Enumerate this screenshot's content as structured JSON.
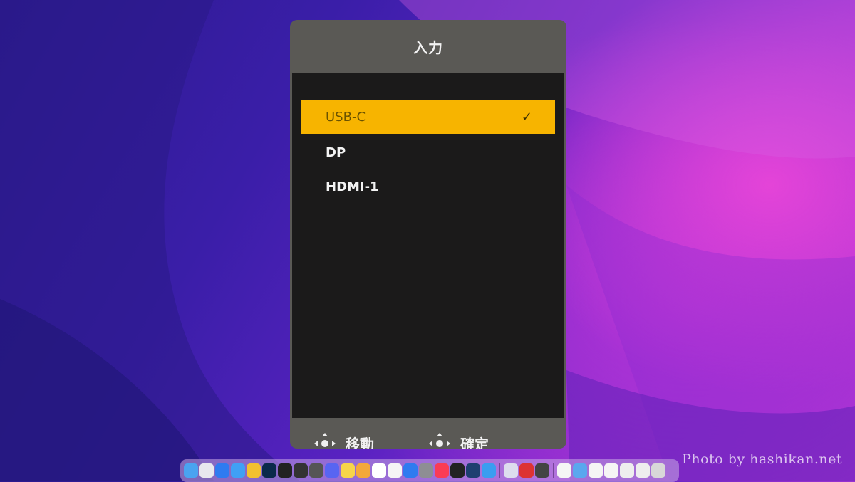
{
  "osd": {
    "title": "入力",
    "items": [
      {
        "label": "USB-C",
        "selected": true
      },
      {
        "label": "DP",
        "selected": false
      },
      {
        "label": "HDMI-1",
        "selected": false
      }
    ],
    "check_mark": "✓",
    "footer": {
      "move_label": "移動",
      "confirm_label": "確定"
    }
  },
  "dock": {
    "icons": [
      "finder-icon",
      "launchpad-icon",
      "app-store-icon",
      "safari-icon",
      "chrome-icon",
      "lightroom-icon",
      "davinci-icon",
      "final-cut-icon",
      "quicktime-icon",
      "discord-icon",
      "notes-icon",
      "photos-icon",
      "reminders-icon",
      "notepad-icon",
      "app-store-2-icon",
      "settings-icon",
      "music-icon",
      "terminal-icon",
      "photoshop-icon",
      "network-icon",
      "separator",
      "preview-icon",
      "pdf-icon",
      "logic-icon",
      "separator",
      "document-icon",
      "folder-icon",
      "document-2-icon",
      "document-3-icon",
      "image-icon",
      "image-2-icon",
      "trash-icon"
    ],
    "colors": [
      "#4aa3f0",
      "#e8e8ee",
      "#2f7bf0",
      "#3fa0f5",
      "#f2c12e",
      "#0b2a4a",
      "#222",
      "#333",
      "#555",
      "#5865f2",
      "#f7d54a",
      "#f4a83b",
      "#ffffff",
      "#f5f5f5",
      "#2f7bf0",
      "#8e8e93",
      "#fa3c55",
      "#222",
      "#1e3f70",
      "#3a9df0",
      "",
      "#dde",
      "#d33",
      "#444",
      "",
      "#f5f5f5",
      "#5aa7ee",
      "#f5f5f5",
      "#f5f5f5",
      "#eee",
      "#eee",
      "#d8d8d8"
    ]
  },
  "watermark": "Photo by hashikan.net",
  "colors": {
    "selected_bg": "#f7b400",
    "panel_bg": "#5a5955",
    "list_bg": "#1b1a1a"
  }
}
